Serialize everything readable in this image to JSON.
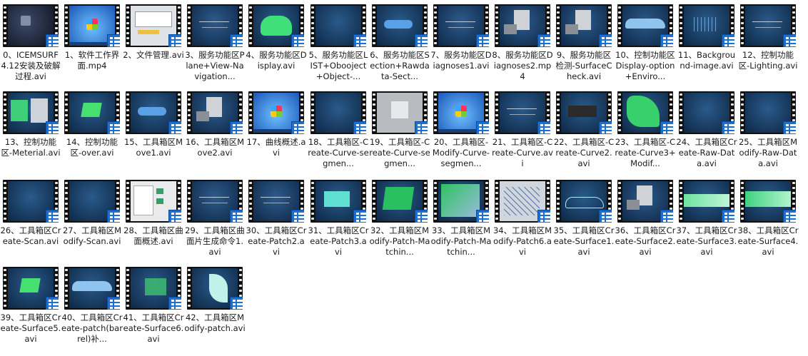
{
  "files": [
    {
      "label": "0、ICEMSURF4.12安装及破解过程.avi",
      "thumb": "win-dark"
    },
    {
      "label": "1、软件工作界面.mp4",
      "thumb": "win7"
    },
    {
      "label": "2、文件管理.avi",
      "thumb": "doc"
    },
    {
      "label": "3、服务功能区Plane+View-Navigation...",
      "thumb": "ui-lines"
    },
    {
      "label": "4、服务功能区Display.avi",
      "thumb": "car-green"
    },
    {
      "label": "5、服务功能区LIST+Obooject+Object-...",
      "thumb": "blue"
    },
    {
      "label": "6、服务功能区Section+Rawdata-Sect...",
      "thumb": "blue-shape"
    },
    {
      "label": "7、服务功能区Diagnoses1.avi",
      "thumb": "ui-lines"
    },
    {
      "label": "8、服务功能区Diagnoses2.mp4",
      "thumb": "ui-dialogs"
    },
    {
      "label": "9、服务功能区检测-SurfaceCheck.avi",
      "thumb": "ui-dialogs"
    },
    {
      "label": "10、控制功能区Display-option+Enviro...",
      "thumb": "car-blue"
    },
    {
      "label": "11、Background-image.avi",
      "thumb": "blue-grid"
    },
    {
      "label": "12、控制功能区-Lighting.avi",
      "thumb": "blue-lines"
    },
    {
      "label": "13、控制功能区-Meterial.avi",
      "thumb": "green-panel"
    },
    {
      "label": "14、控制功能区-over.avi",
      "thumb": "green-small"
    },
    {
      "label": "15、工具箱区Move1.avi",
      "thumb": "blue-shape"
    },
    {
      "label": "16、工具箱区Move2.avi",
      "thumb": "ui-dialogs"
    },
    {
      "label": "17、曲线概述.avi",
      "thumb": "win7"
    },
    {
      "label": "18、工具箱区-Create-Curve-segmen...",
      "thumb": "blue"
    },
    {
      "label": "19、工具箱区-Create-Curve-segmen...",
      "thumb": "gray"
    },
    {
      "label": "20、工具箱区-Modify-Curve-segmen...",
      "thumb": "win7"
    },
    {
      "label": "21、工具箱区-Create-Curve.avi",
      "thumb": "blue-lines"
    },
    {
      "label": "22、工具箱区-Create-Curve2.avi",
      "thumb": "dark-panel"
    },
    {
      "label": "23、工具箱区-Create-Curve3+Modif...",
      "thumb": "green-shape"
    },
    {
      "label": "24、工具箱区Create-Raw-Data.avi",
      "thumb": "blue"
    },
    {
      "label": "25、工具箱区Modify-Raw-Data.avi",
      "thumb": "blue"
    },
    {
      "label": "26、工具箱区Create-Scan.avi",
      "thumb": "blue"
    },
    {
      "label": "27、工具箱区Modify-Scan.avi",
      "thumb": "blue"
    },
    {
      "label": "28、工具箱区曲面概述.avi",
      "thumb": "doc-green"
    },
    {
      "label": "29、工具箱区曲面片生成命令1.avi",
      "thumb": "ui-lines"
    },
    {
      "label": "30、工具箱区Create-Patch2.avi",
      "thumb": "ui-lines"
    },
    {
      "label": "31、工具箱区Create-Patch3.avi",
      "thumb": "cyan-rect"
    },
    {
      "label": "32、工具箱区Modify-Patch-Matchin...",
      "thumb": "green-patch"
    },
    {
      "label": "33、工具箱区Modify-Patch-Matchin...",
      "thumb": "green-ui"
    },
    {
      "label": "34、工具箱区Modify-Patch6.avi",
      "thumb": "wire"
    },
    {
      "label": "35、工具箱区Create-Surface1.avi",
      "thumb": "car-outline"
    },
    {
      "label": "36、工具箱区Create-Surface2.avi",
      "thumb": "ui-dialogs"
    },
    {
      "label": "37、工具箱区Create-Surface3.avi",
      "thumb": "green-band"
    },
    {
      "label": "38、工具箱区Create-Surface4.avi",
      "thumb": "green-band2"
    },
    {
      "label": "39、工具箱区Create-Surface5.avi",
      "thumb": "green-small"
    },
    {
      "label": "40、工具箱区Create-patch(barrel)补...",
      "thumb": "car-blue"
    },
    {
      "label": "41、工具箱区Create-Surface6.avi",
      "thumb": "blue-green"
    },
    {
      "label": "42、工具箱区Modify-patch.avi",
      "thumb": "cyan-curve"
    }
  ],
  "colors": {
    "badge": "#1b6fd1",
    "filmstrip": "#111111",
    "label": "#1a1a1a"
  }
}
